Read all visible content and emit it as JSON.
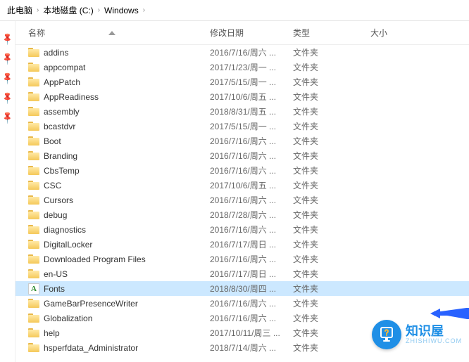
{
  "breadcrumb": {
    "seg0": "此电脑",
    "seg1": "本地磁盘 (C:)",
    "seg2": "Windows"
  },
  "headers": {
    "name": "名称",
    "date": "修改日期",
    "type": "类型",
    "size": "大小"
  },
  "type_folder": "文件夹",
  "fonts_glyph": "A",
  "rows": [
    {
      "name": "addins",
      "date": "2016/7/16/周六 ...",
      "icon": "folder"
    },
    {
      "name": "appcompat",
      "date": "2017/1/23/周一 ...",
      "icon": "folder"
    },
    {
      "name": "AppPatch",
      "date": "2017/5/15/周一 ...",
      "icon": "folder"
    },
    {
      "name": "AppReadiness",
      "date": "2017/10/6/周五 ...",
      "icon": "folder"
    },
    {
      "name": "assembly",
      "date": "2018/8/31/周五 ...",
      "icon": "folder"
    },
    {
      "name": "bcastdvr",
      "date": "2017/5/15/周一 ...",
      "icon": "folder"
    },
    {
      "name": "Boot",
      "date": "2016/7/16/周六 ...",
      "icon": "folder"
    },
    {
      "name": "Branding",
      "date": "2016/7/16/周六 ...",
      "icon": "folder"
    },
    {
      "name": "CbsTemp",
      "date": "2016/7/16/周六 ...",
      "icon": "folder"
    },
    {
      "name": "CSC",
      "date": "2017/10/6/周五 ...",
      "icon": "folder"
    },
    {
      "name": "Cursors",
      "date": "2016/7/16/周六 ...",
      "icon": "folder"
    },
    {
      "name": "debug",
      "date": "2018/7/28/周六 ...",
      "icon": "folder"
    },
    {
      "name": "diagnostics",
      "date": "2016/7/16/周六 ...",
      "icon": "folder"
    },
    {
      "name": "DigitalLocker",
      "date": "2016/7/17/周日 ...",
      "icon": "folder"
    },
    {
      "name": "Downloaded Program Files",
      "date": "2016/7/16/周六 ...",
      "icon": "folder"
    },
    {
      "name": "en-US",
      "date": "2016/7/17/周日 ...",
      "icon": "folder"
    },
    {
      "name": "Fonts",
      "date": "2018/8/30/周四 ...",
      "icon": "fonts",
      "selected": true
    },
    {
      "name": "GameBarPresenceWriter",
      "date": "2016/7/16/周六 ...",
      "icon": "folder"
    },
    {
      "name": "Globalization",
      "date": "2016/7/16/周六 ...",
      "icon": "folder"
    },
    {
      "name": "help",
      "date": "2017/10/11/周三 ...",
      "icon": "folder"
    },
    {
      "name": "hsperfdata_Administrator",
      "date": "2018/7/14/周六 ...",
      "icon": "folder"
    }
  ],
  "badge": {
    "cn": "知识屋",
    "py": "ZHISHIWU.COM"
  }
}
